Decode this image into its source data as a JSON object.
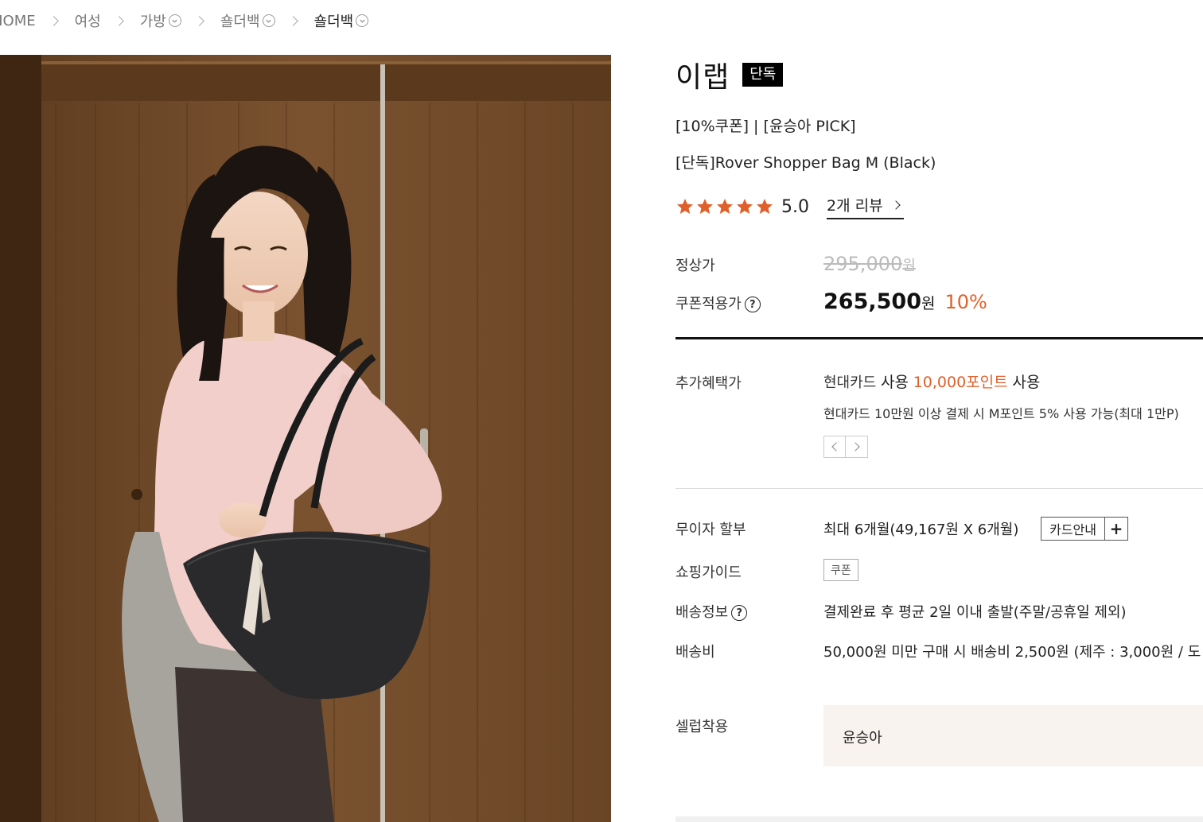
{
  "breadcrumb": {
    "home": "HOME",
    "women": "여성",
    "bags": "가방",
    "shoulder1": "숄더백",
    "shoulder2": "숄더백"
  },
  "product": {
    "brand": "이랩",
    "exclusive_badge": "단독",
    "promo_line": "[10%쿠폰] | [윤승아 PICK]",
    "name": "[단독]Rover Shopper Bag M (Black)",
    "rating_value": 5.0,
    "rating_text": "5.0",
    "review_link": "2개 리뷰"
  },
  "price": {
    "regular_label": "정상가",
    "regular_price": "295,000",
    "regular_unit": "원",
    "coupon_label": "쿠폰적용가",
    "coupon_price": "265,500",
    "coupon_unit": "원",
    "discount": "10%"
  },
  "benefits": {
    "label": "추가혜택가",
    "card_name": "현대카드",
    "use1": "사용",
    "points": "10,000포인트",
    "use2": "사용",
    "note": "현대카드 10만원 이상 결제 시 M포인트 5% 사용 가능(최대 1만P)"
  },
  "installment": {
    "label": "무이자 할부",
    "value": "최대 6개월(49,167원 X 6개월)",
    "card_guide": "카드안내",
    "plus": "+"
  },
  "shopping_guide": {
    "label": "쇼핑가이드",
    "tag": "쿠폰"
  },
  "shipping_info": {
    "label": "배송정보",
    "value": "결제완료 후 평균 2일 이내 출발(주말/공휴일 제외)"
  },
  "shipping_fee": {
    "label": "배송비",
    "value": "50,000원 미만 구매 시 배송비 2,500원 (제주 : 3,000원 / 도"
  },
  "celeb": {
    "label": "셀럽착용",
    "name": "윤승아"
  },
  "colors": {
    "accent": "#e0602a",
    "star": "#e0602a",
    "badge_bg": "#000000",
    "celeb_bg": "#f8f3ef"
  }
}
